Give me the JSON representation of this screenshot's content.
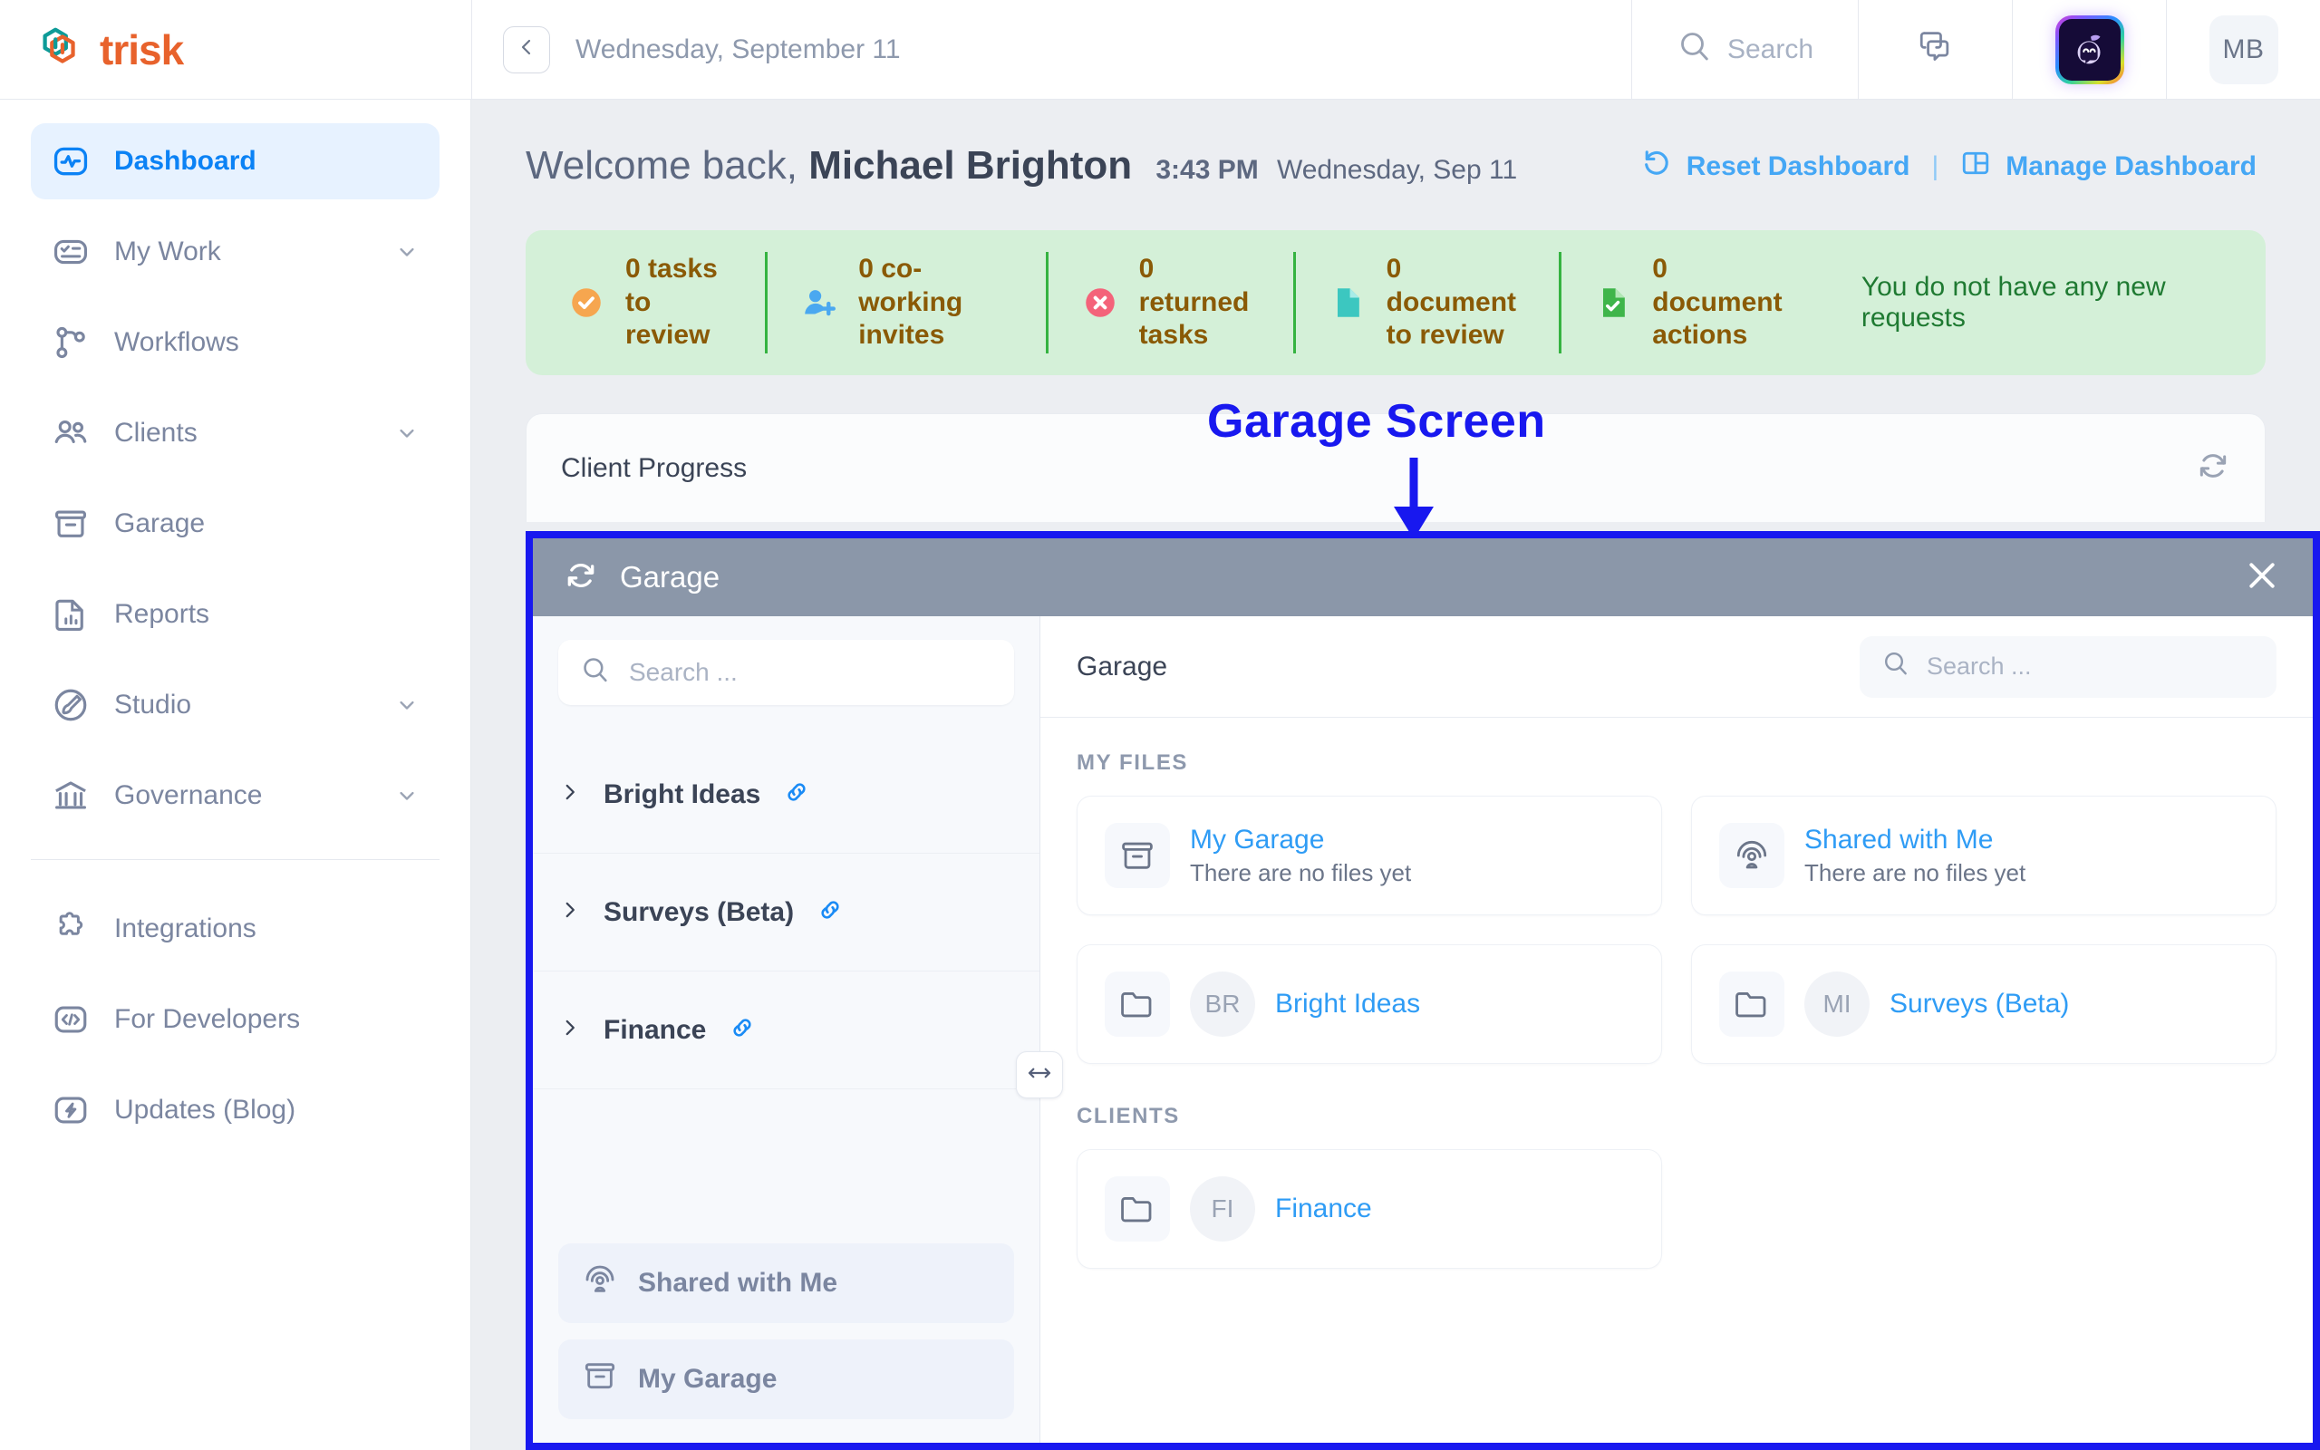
{
  "brand": {
    "name": "trisk",
    "logo_icon": "trisk-hexagon-logo",
    "color": "#e8622c",
    "accent": "#0d9b98"
  },
  "topbar": {
    "back_icon": "chevron-left-icon",
    "date": "Wednesday, September 11",
    "search_label": "Search",
    "search_icon": "search-icon",
    "chat_icon": "chat-bubbles-icon",
    "ai_assistant_icon": "ai-assistant-avatar-icon",
    "user_initials": "MB"
  },
  "sidebar": {
    "items": [
      {
        "label": "Dashboard",
        "icon": "activity-pulse-icon",
        "active": true,
        "chevron": false
      },
      {
        "label": "My Work",
        "icon": "task-list-icon",
        "active": false,
        "chevron": true
      },
      {
        "label": "Workflows",
        "icon": "workflow-branch-icon",
        "active": false,
        "chevron": false
      },
      {
        "label": "Clients",
        "icon": "users-icon",
        "active": false,
        "chevron": true
      },
      {
        "label": "Garage",
        "icon": "archive-box-icon",
        "active": false,
        "chevron": false
      },
      {
        "label": "Reports",
        "icon": "document-chart-icon",
        "active": false,
        "chevron": false
      },
      {
        "label": "Studio",
        "icon": "brush-circle-icon",
        "active": false,
        "chevron": true
      },
      {
        "label": "Governance",
        "icon": "bank-columns-icon",
        "active": false,
        "chevron": true
      }
    ],
    "secondary_items": [
      {
        "label": "Integrations",
        "icon": "puzzle-piece-icon"
      },
      {
        "label": "For Developers",
        "icon": "code-brackets-icon"
      },
      {
        "label": "Updates (Blog)",
        "icon": "lightning-bolt-icon"
      }
    ]
  },
  "welcome": {
    "greeting": "Welcome back,",
    "user_name": "Michael Brighton",
    "time": "3:43 PM",
    "date": "Wednesday, Sep 11",
    "reset_label": "Reset Dashboard",
    "reset_icon": "reset-arrow-icon",
    "divider": "|",
    "manage_label": "Manage Dashboard",
    "manage_icon": "layout-panels-icon",
    "link_color": "#45a7f5"
  },
  "banner": {
    "background": "#d4f0d8",
    "items": [
      {
        "count": "0 tasks",
        "sub": "to review",
        "icon": "check-circle-icon",
        "icon_color": "#f6a64f"
      },
      {
        "count": "0 co-working",
        "sub": "invites",
        "icon": "user-plus-icon",
        "icon_color": "#4aa8f0"
      },
      {
        "count": "0 returned",
        "sub": "tasks",
        "icon": "x-circle-icon",
        "icon_color": "#f4637a"
      },
      {
        "count": "0 document",
        "sub": "to review",
        "icon": "document-icon",
        "icon_color": "#3cc7c0"
      },
      {
        "count": "0 document",
        "sub": "actions",
        "icon": "document-check-icon",
        "icon_color": "#3fb54a"
      }
    ],
    "note": "You do not have any new requests",
    "note_color": "#1f7a32"
  },
  "widget": {
    "title": "Client Progress",
    "refresh_icon": "refresh-icon"
  },
  "annotation": {
    "text": "Garage Screen",
    "color": "#1818ef",
    "arrow_icon": "down-arrow-icon"
  },
  "modal": {
    "border_color": "#1818ef",
    "header": {
      "title": "Garage",
      "refresh_icon": "refresh-icon",
      "close_icon": "close-x-icon",
      "background": "#8b97a9"
    },
    "tree": {
      "search_placeholder": "Search ...",
      "search_icon": "search-icon",
      "rows": [
        {
          "label": "Bright Ideas",
          "chevron_icon": "chevron-right-icon",
          "link_icon": "link-icon"
        },
        {
          "label": "Surveys (Beta)",
          "chevron_icon": "chevron-right-icon",
          "link_icon": "link-icon"
        },
        {
          "label": "Finance",
          "chevron_icon": "chevron-right-icon",
          "link_icon": "link-icon"
        }
      ],
      "pills": [
        {
          "label": "Shared with Me",
          "icon": "shared-radar-icon"
        },
        {
          "label": "My Garage",
          "icon": "archive-box-icon"
        }
      ],
      "resize_icon": "horizontal-resize-icon"
    },
    "content": {
      "breadcrumb": "Garage",
      "search_placeholder": "Search ...",
      "search_icon": "search-icon",
      "sections": [
        {
          "label": "MY FILES",
          "cards": [
            {
              "title": "My Garage",
              "subtitle": "There are no files yet",
              "icon": "archive-box-icon",
              "initials": ""
            },
            {
              "title": "Shared with Me",
              "subtitle": "There are no files yet",
              "icon": "shared-radar-icon",
              "initials": ""
            },
            {
              "title": "Bright Ideas",
              "subtitle": "",
              "icon": "folder-icon",
              "initials": "BR"
            },
            {
              "title": "Surveys (Beta)",
              "subtitle": "",
              "icon": "folder-icon",
              "initials": "MI"
            }
          ]
        },
        {
          "label": "CLIENTS",
          "cards": [
            {
              "title": "Finance",
              "subtitle": "",
              "icon": "folder-icon",
              "initials": "FI"
            }
          ]
        }
      ]
    }
  }
}
